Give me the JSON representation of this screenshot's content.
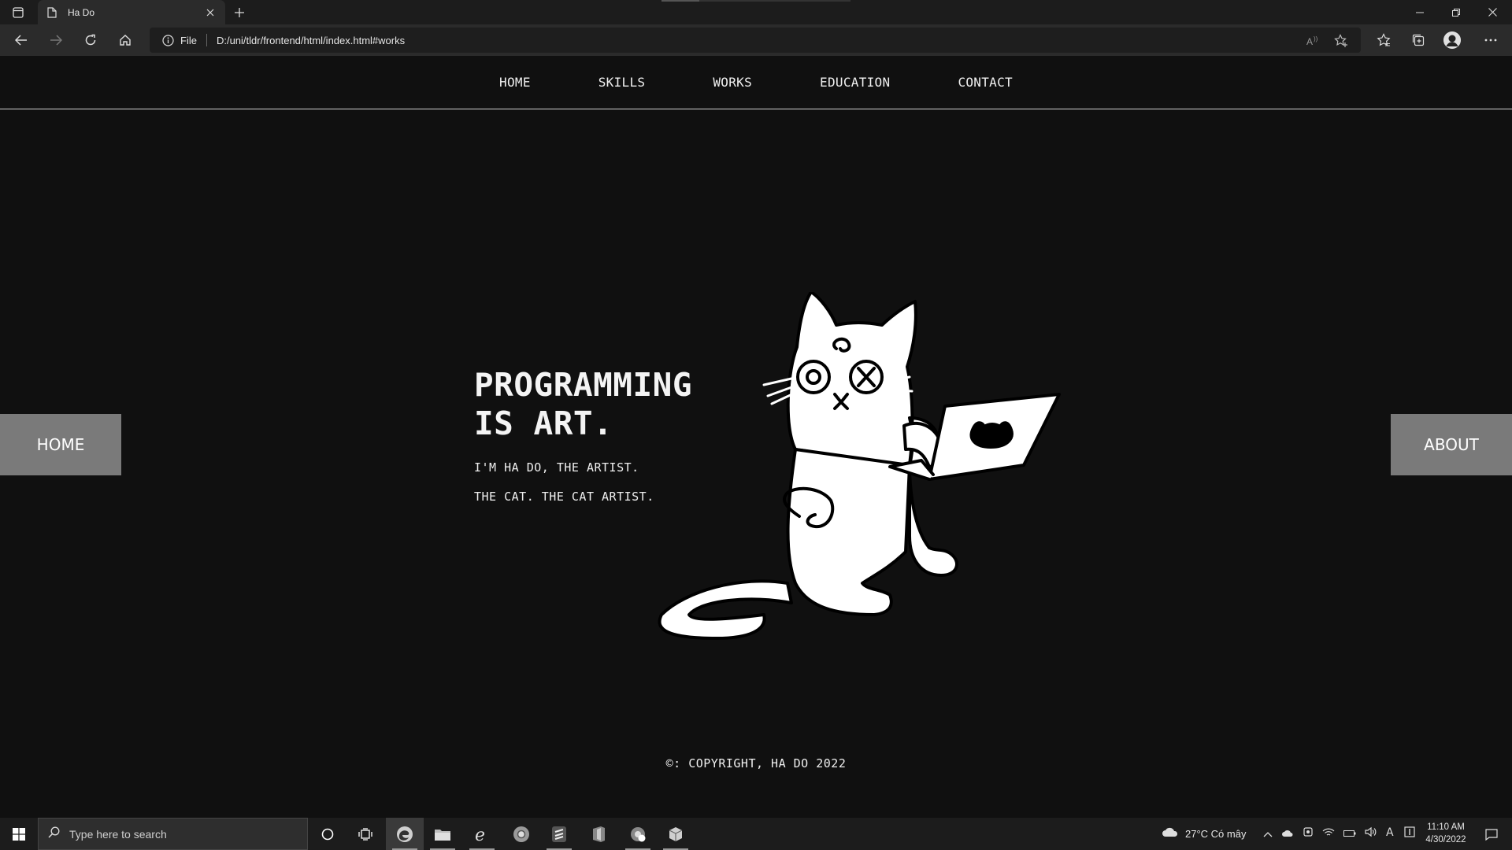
{
  "browser": {
    "tab_title": "Ha Do",
    "scheme_label": "File",
    "url": "D:/uni/tldr/frontend/html/index.html#works"
  },
  "site": {
    "nav": [
      "HOME",
      "SKILLS",
      "WORKS",
      "EDUCATION",
      "CONTACT"
    ],
    "side_left": "HOME",
    "side_right": "ABOUT",
    "hero_title": "PROGRAMMING\nIS ART.",
    "hero_line1": "I'M HA DO, THE ARTIST.",
    "hero_line2": "THE CAT. THE CAT ARTIST.",
    "footer": "©: COPYRIGHT, HA DO 2022"
  },
  "taskbar": {
    "search_placeholder": "Type here to search",
    "weather": "27°C  Có mây",
    "time": "11:10 AM",
    "date": "4/30/2022"
  },
  "colors": {
    "page_bg": "#101010",
    "side_button_bg": "#7a7a7a",
    "browser_chrome": "#2b2b2b"
  }
}
